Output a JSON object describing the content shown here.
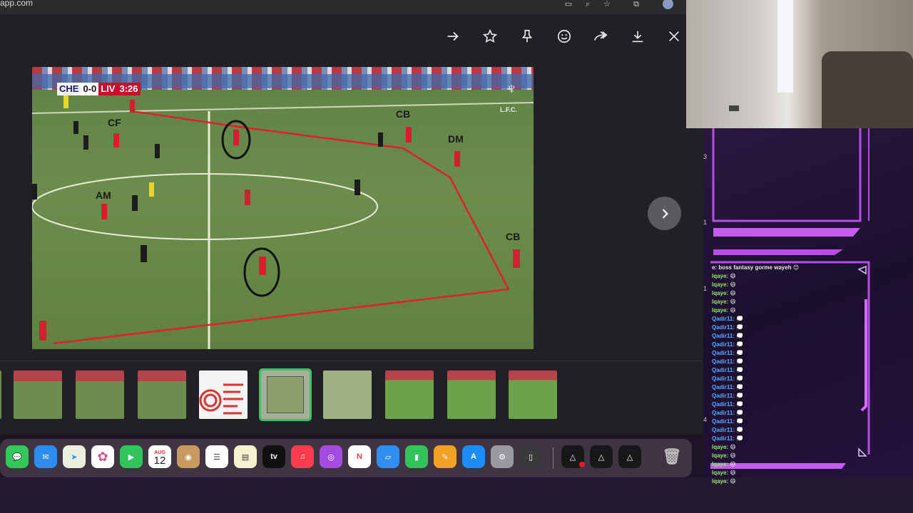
{
  "browser": {
    "url": "app.com"
  },
  "viewer": {
    "toolbar": [
      "→",
      "☆",
      "⌖",
      "☺",
      "⇢",
      "⤓",
      "✕"
    ],
    "next_label": "›"
  },
  "image": {
    "score": {
      "home": "CHE",
      "score": "0-0",
      "away": "LIV",
      "time": "3:26"
    },
    "club_mark": "L.F.C.",
    "position_labels": [
      {
        "id": "cf",
        "text": "CF"
      },
      {
        "id": "am",
        "text": "AM"
      },
      {
        "id": "cb1",
        "text": "CB"
      },
      {
        "id": "dm",
        "text": "DM"
      },
      {
        "id": "cb2",
        "text": "CB"
      }
    ]
  },
  "dock": {
    "calendar_month": "AUG",
    "calendar_day": "12",
    "tv_label": "tv"
  },
  "chat": {
    "lines": [
      {
        "user": "e: boss fantasy gorme wayeh",
        "msg": "😊",
        "style": "msg"
      },
      {
        "user": "lqaye:",
        "msg": "😄",
        "style": "a"
      },
      {
        "user": "lqaye:",
        "msg": "😄",
        "style": "a"
      },
      {
        "user": "lqaye:",
        "msg": "😄",
        "style": "a"
      },
      {
        "user": "lqaye:",
        "msg": "😄",
        "style": "a"
      },
      {
        "user": "lqaye:",
        "msg": "😄",
        "style": "a"
      },
      {
        "user": "Qadir11:",
        "msg": "💭",
        "style": "b"
      },
      {
        "user": "Qadir11:",
        "msg": "💭",
        "style": "b"
      },
      {
        "user": "Qadir11:",
        "msg": "💭",
        "style": "b"
      },
      {
        "user": "Qadir11:",
        "msg": "💭",
        "style": "b"
      },
      {
        "user": "Qadir11:",
        "msg": "💭",
        "style": "b"
      },
      {
        "user": "Qadir11:",
        "msg": "💭",
        "style": "b"
      },
      {
        "user": "Qadir11:",
        "msg": "💭",
        "style": "b"
      },
      {
        "user": "Qadir11:",
        "msg": "💭",
        "style": "b"
      },
      {
        "user": "Qadir11:",
        "msg": "💭",
        "style": "b"
      },
      {
        "user": "Qadir11:",
        "msg": "💭",
        "style": "b"
      },
      {
        "user": "Qadir11:",
        "msg": "💭",
        "style": "b"
      },
      {
        "user": "Qadir11:",
        "msg": "💭",
        "style": "b"
      },
      {
        "user": "Qadir11:",
        "msg": "💭",
        "style": "b"
      },
      {
        "user": "Qadir11:",
        "msg": "💭",
        "style": "b"
      },
      {
        "user": "Qadir11:",
        "msg": "💭",
        "style": "b"
      },
      {
        "user": "lqaye:",
        "msg": "😄",
        "style": "a"
      },
      {
        "user": "lqaye:",
        "msg": "😄",
        "style": "a"
      },
      {
        "user": "lqaye:",
        "msg": "😄",
        "style": "a"
      },
      {
        "user": "lqaye:",
        "msg": "😄",
        "style": "a"
      },
      {
        "user": "lqaye:",
        "msg": "😄",
        "style": "a"
      }
    ],
    "side_numbers": [
      "3",
      "1",
      "1",
      "4"
    ]
  },
  "colors": {
    "accent": "#b84ce6",
    "selected_thumb": "#3ac26a",
    "annotation": "#e0202a"
  }
}
